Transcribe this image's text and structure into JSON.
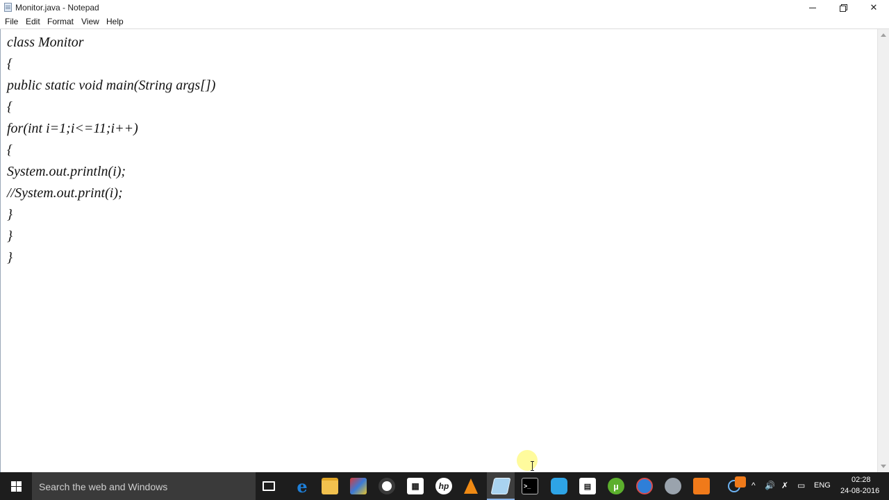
{
  "window": {
    "title": "Monitor.java - Notepad"
  },
  "menu": {
    "file": "File",
    "edit": "Edit",
    "format": "Format",
    "view": "View",
    "help": "Help"
  },
  "editor": {
    "lines": [
      "class Monitor",
      "{",
      "public static void main(String args[])",
      "{",
      "for(int i=1;i<=11;i++)",
      "{",
      "System.out.println(i);",
      "//System.out.print(i);",
      "}",
      "}",
      "}"
    ]
  },
  "taskbar": {
    "search_placeholder": "Search the web and Windows",
    "language": "ENG",
    "time": "02:28",
    "date": "24-08-2016",
    "icons": [
      "task-view",
      "edge",
      "file-explorer",
      "app",
      "chrome",
      "store",
      "hp",
      "vlc",
      "notepad",
      "cmd",
      "app-blue",
      "calculator",
      "utorrent",
      "app-globe",
      "app-gray",
      "app-orange"
    ]
  },
  "colors": {
    "taskbar_bg": "#1d1d1d",
    "search_bg": "#3a3a3a",
    "text": "#111111"
  }
}
